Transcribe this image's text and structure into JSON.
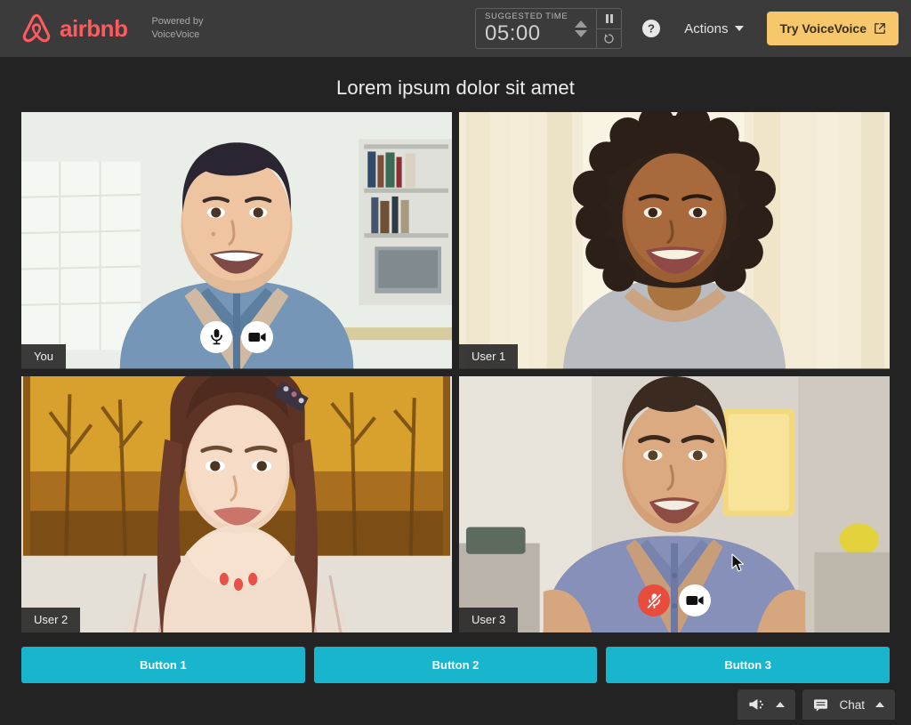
{
  "header": {
    "brand_name": "airbnb",
    "brand_color": "#ff5a5f",
    "powered_line1": "Powered by",
    "powered_line2": "VoiceVoice",
    "timer": {
      "label": "SUGGESTED TIME",
      "value": "05:00",
      "increase_icon": "caret-up-icon",
      "decrease_icon": "caret-down-icon",
      "pause_icon": "pause-icon",
      "reset_icon": "reset-icon"
    },
    "help_icon": "help-circle-icon",
    "actions_label": "Actions",
    "actions_caret_icon": "chevron-down-icon",
    "try_button_label": "Try VoiceVoice",
    "try_button_icon": "external-link-icon",
    "try_button_color": "#f7c76b"
  },
  "main": {
    "title": "Lorem ipsum dolor sit amet",
    "tiles": [
      {
        "name": "You",
        "mic_state": "unmuted",
        "mic_icon": "microphone-icon",
        "camera_icon": "video-camera-icon",
        "has_controls": true,
        "has_cursor": false
      },
      {
        "name": "User 1",
        "mic_state": "unmuted",
        "mic_icon": "microphone-icon",
        "camera_icon": "video-camera-icon",
        "has_controls": false,
        "has_cursor": false
      },
      {
        "name": "User 2",
        "mic_state": "unmuted",
        "mic_icon": "microphone-icon",
        "camera_icon": "video-camera-icon",
        "has_controls": false,
        "has_cursor": false
      },
      {
        "name": "User 3",
        "mic_state": "muted",
        "mic_icon": "microphone-muted-icon",
        "camera_icon": "video-camera-icon",
        "has_controls": true,
        "has_cursor": true
      }
    ],
    "cta_buttons": [
      {
        "label": "Button 1"
      },
      {
        "label": "Button 2"
      },
      {
        "label": "Button 3"
      }
    ],
    "cta_color": "#18b5cd"
  },
  "bottom_bar": {
    "broadcast_icon": "megaphone-icon",
    "broadcast_caret_icon": "chevron-up-icon",
    "chat_icon": "chat-bubble-icon",
    "chat_label": "Chat",
    "chat_caret_icon": "chevron-up-icon"
  }
}
